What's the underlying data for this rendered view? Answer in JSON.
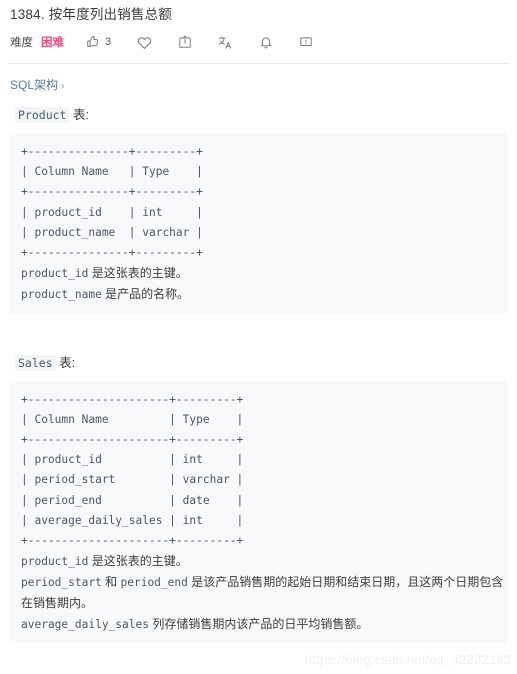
{
  "header": {
    "title": "1384. 按年度列出销售总额",
    "difficulty_label": "难度",
    "difficulty_value": "困难",
    "difficulty_color": "#ef4b81",
    "like_count": "3",
    "icons": {
      "thumbs_up": "thumbs-up-icon",
      "heart": "heart-icon",
      "share": "share-icon",
      "translate": "translate-icon",
      "bell": "bell-icon",
      "comment": "comment-icon"
    }
  },
  "schema": {
    "link_label": "SQL架构",
    "chevron": "›"
  },
  "product_section": {
    "table_name": "Product",
    "heading_suffix": "表:",
    "code": "+---------------+---------+\n| Column Name   | Type    |\n+---------------+---------+\n| product_id    | int     |\n| product_name  | varchar |\n+---------------+---------+",
    "note_1_code": "product_id",
    "note_1_text": " 是这张表的主键。",
    "note_2_code": "product_name",
    "note_2_text": " 是产品的名称。"
  },
  "sales_section": {
    "table_name": "Sales",
    "heading_suffix": "表:",
    "code": "+---------------------+---------+\n| Column Name         | Type    |\n+---------------------+---------+\n| product_id          | int     |\n| period_start        | varchar |\n| period_end          | date    |\n| average_daily_sales | int     |\n+---------------------+---------+",
    "note_1_code": "product_id",
    "note_1_text": " 是这张表的主键。",
    "note_2_code_a": "period_start",
    "note_2_mid": " 和 ",
    "note_2_code_b": "period_end",
    "note_2_text": " 是该产品销售期的起始日期和结束日期，且这两个日期包含在销售期内。",
    "note_3_code": "average_daily_sales",
    "note_3_text": " 列存储销售期内该产品的日平均销售额。"
  },
  "watermark": {
    "text": "https://blog.csdn.net/qq_42232193"
  }
}
